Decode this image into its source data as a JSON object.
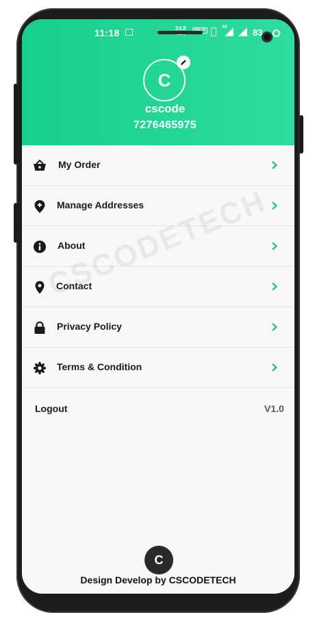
{
  "status_bar": {
    "time": "11:18",
    "speed_value": "24.8",
    "speed_unit": "KB/S",
    "lte": "VoLTE",
    "network": "4G",
    "battery": "83"
  },
  "profile": {
    "avatar_letter": "C",
    "name": "cscode",
    "phone": "7276465975"
  },
  "menu": {
    "items": [
      {
        "label": "My Order",
        "icon": "basket-icon"
      },
      {
        "label": "Manage Addresses",
        "icon": "add-location-icon"
      },
      {
        "label": "About",
        "icon": "info-icon"
      },
      {
        "label": "Contact",
        "icon": "location-pin-icon"
      },
      {
        "label": "Privacy Policy",
        "icon": "lock-icon"
      },
      {
        "label": "Terms & Condition",
        "icon": "gear-icon"
      }
    ]
  },
  "logout": {
    "label": "Logout",
    "version": "V1.0"
  },
  "watermark": "CSCODETECH",
  "footer": {
    "logo_letter": "C",
    "text": "Design Develop by CSCODETECH"
  },
  "colors": {
    "accent": "#1fd493",
    "chevron": "#1fbf87",
    "text": "#1a1a1a"
  }
}
